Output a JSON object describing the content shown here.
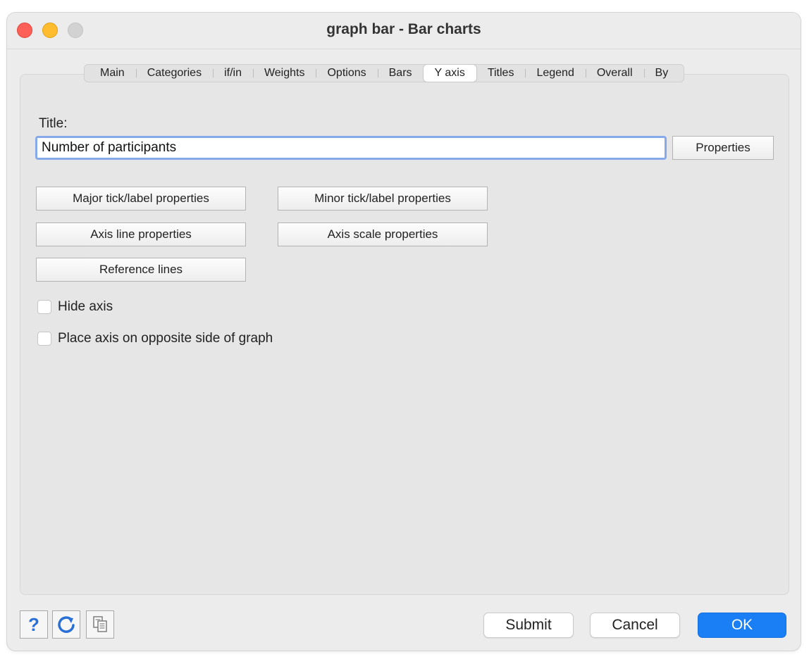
{
  "window": {
    "title": "graph bar - Bar charts"
  },
  "tabs": [
    {
      "label": "Main"
    },
    {
      "label": "Categories"
    },
    {
      "label": "if/in"
    },
    {
      "label": "Weights"
    },
    {
      "label": "Options"
    },
    {
      "label": "Bars"
    },
    {
      "label": "Y axis",
      "active": true
    },
    {
      "label": "Titles"
    },
    {
      "label": "Legend"
    },
    {
      "label": "Overall"
    },
    {
      "label": "By"
    }
  ],
  "yaxis": {
    "title_label": "Title:",
    "title_value": "Number of participants",
    "properties_label": "Properties",
    "major_tick_label": "Major tick/label properties",
    "minor_tick_label": "Minor tick/label properties",
    "axis_line_label": "Axis line properties",
    "axis_scale_label": "Axis scale properties",
    "reference_lines_label": "Reference lines",
    "hide_axis_label": "Hide axis",
    "hide_axis_checked": false,
    "opposite_side_label": "Place axis on opposite side of graph",
    "opposite_side_checked": false
  },
  "footer": {
    "help_icon": "help-icon",
    "reset_icon": "refresh-icon",
    "copy_icon": "copy-command-icon",
    "submit_label": "Submit",
    "cancel_label": "Cancel",
    "ok_label": "OK"
  },
  "colors": {
    "accent": "#1a7ef5",
    "focus_ring": "#86a9ea",
    "close": "#fe5f57",
    "minimize": "#febc2e",
    "zoom_disabled": "#d2d2d2"
  }
}
